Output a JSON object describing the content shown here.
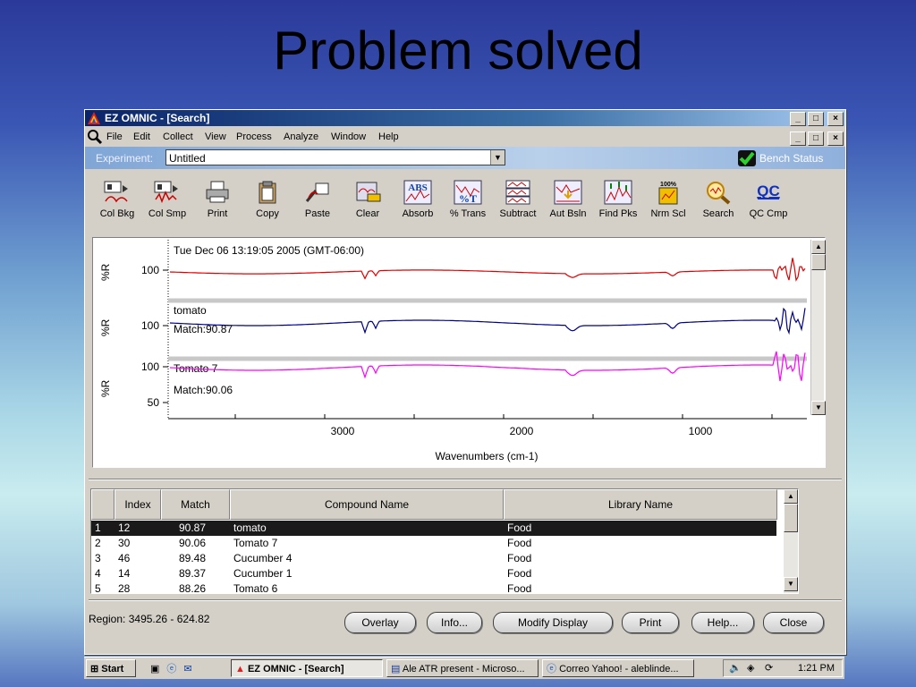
{
  "slide": {
    "title": "Problem solved"
  },
  "window": {
    "title": "EZ OMNIC - [Search]",
    "min": "_",
    "max": "□",
    "close": "×"
  },
  "menu": [
    "File",
    "Edit",
    "Collect",
    "View",
    "Process",
    "Analyze",
    "Window",
    "Help"
  ],
  "experiment": {
    "label": "Experiment:",
    "value": "Untitled",
    "bench_status": "Bench Status"
  },
  "toolbar": [
    {
      "label": "Col Bkg",
      "icon": "collect-background-icon"
    },
    {
      "label": "Col Smp",
      "icon": "collect-sample-icon"
    },
    {
      "label": "Print",
      "icon": "printer-icon"
    },
    {
      "label": "Copy",
      "icon": "clipboard-copy-icon"
    },
    {
      "label": "Paste",
      "icon": "paste-icon"
    },
    {
      "label": "Clear",
      "icon": "clear-icon"
    },
    {
      "label": "Absorb",
      "icon": "absorbance-icon"
    },
    {
      "label": "% Trans",
      "icon": "transmittance-icon"
    },
    {
      "label": "Subtract",
      "icon": "subtract-icon"
    },
    {
      "label": "Aut Bsln",
      "icon": "auto-baseline-icon"
    },
    {
      "label": "Find Pks",
      "icon": "find-peaks-icon"
    },
    {
      "label": "Nrm Scl",
      "icon": "normalize-scale-icon"
    },
    {
      "label": "Search",
      "icon": "search-icon"
    },
    {
      "label": "QC Cmp",
      "icon": "qc-compare-icon"
    }
  ],
  "toolbar_icon_text": {
    "absorb": "ABS",
    "trans": "%T",
    "nrm": "100%",
    "qc": "QC"
  },
  "spectrum": {
    "timestamp": "Tue Dec 06 13:19:05 2005 (GMT-06:00)",
    "panel2_name": "tomato",
    "panel2_match": "Match:90.87",
    "panel3_name": "Tomato 7",
    "panel3_match": "Match:90.06",
    "ylabel": "%R",
    "tick_100a": "100",
    "tick_100b": "100",
    "tick_100c": "100",
    "tick_50": "50",
    "xlabel": "Wavenumbers (cm-1)",
    "xticks": [
      "3000",
      "2000",
      "1000"
    ],
    "colors": {
      "sample": "#e00000",
      "match1": "#000080",
      "match2": "#ff00ff"
    }
  },
  "results": {
    "columns": [
      "Index",
      "Match",
      "Compound Name",
      "Library Name"
    ],
    "rows": [
      {
        "n": "1",
        "index": "12",
        "match": "90.87",
        "name": "tomato",
        "library": "Food"
      },
      {
        "n": "2",
        "index": "30",
        "match": "90.06",
        "name": "Tomato 7",
        "library": "Food"
      },
      {
        "n": "3",
        "index": "46",
        "match": "89.48",
        "name": "Cucumber 4",
        "library": "Food"
      },
      {
        "n": "4",
        "index": "14",
        "match": "89.37",
        "name": "Cucumber 1",
        "library": "Food"
      },
      {
        "n": "5",
        "index": "28",
        "match": "88.26",
        "name": "Tomato 6",
        "library": "Food"
      }
    ]
  },
  "footer": {
    "region_label": "Region:",
    "region_value": "3495.26  -  624.82",
    "buttons": [
      "Overlay",
      "Info...",
      "Modify Display",
      "Print",
      "Help...",
      "Close"
    ]
  },
  "taskbar": {
    "start": "Start",
    "tasks": [
      "EZ OMNIC - [Search]",
      "Ale ATR present - Microso...",
      "Correo Yahoo! - aleblinde..."
    ],
    "clock": "1:21 PM"
  }
}
